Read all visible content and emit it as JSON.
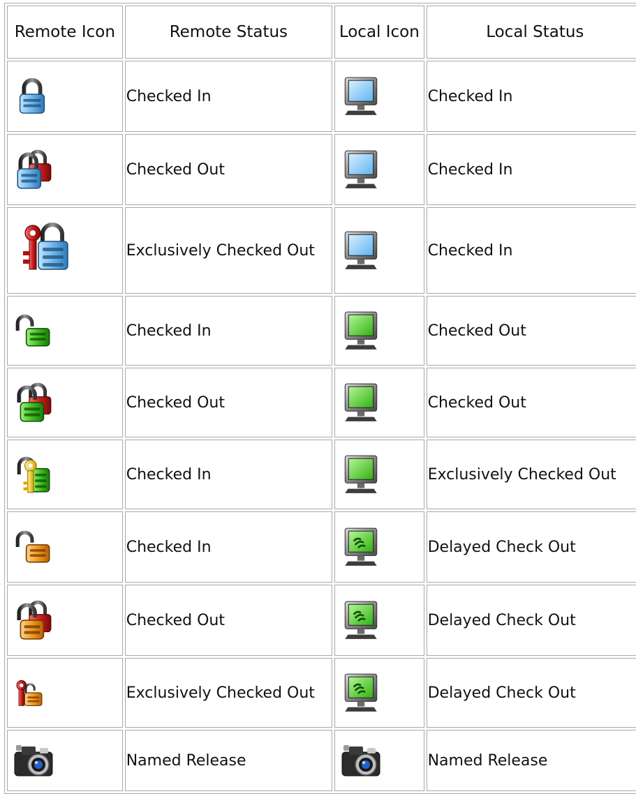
{
  "headers": {
    "remote_icon": "Remote Icon",
    "remote_status": "Remote Status",
    "local_icon": "Local Icon",
    "local_status": "Local Status"
  },
  "rows": [
    {
      "remote_icon": "blue-lock-closed-icon",
      "remote_status": "Checked In",
      "local_icon": "monitor-blue-icon",
      "local_status": "Checked In"
    },
    {
      "remote_icon": "blue-lock-checked-out-icon",
      "remote_status": "Checked Out",
      "local_icon": "monitor-blue-icon",
      "local_status": "Checked In"
    },
    {
      "remote_icon": "blue-lock-exclusive-key-icon",
      "remote_status": "Exclusively Checked Out",
      "local_icon": "monitor-blue-icon",
      "local_status": "Checked In"
    },
    {
      "remote_icon": "green-lock-open-icon",
      "remote_status": "Checked In",
      "local_icon": "monitor-green-icon",
      "local_status": "Checked Out"
    },
    {
      "remote_icon": "green-lock-checked-out-icon",
      "remote_status": "Checked Out",
      "local_icon": "monitor-green-icon",
      "local_status": "Checked Out"
    },
    {
      "remote_icon": "green-lock-yellow-key-icon",
      "remote_status": "Checked In",
      "local_icon": "monitor-green-icon",
      "local_status": "Exclusively Checked Out"
    },
    {
      "remote_icon": "orange-lock-open-icon",
      "remote_status": "Checked In",
      "local_icon": "monitor-green-delayed-icon",
      "local_status": "Delayed Check Out"
    },
    {
      "remote_icon": "orange-lock-checked-out-icon",
      "remote_status": "Checked Out",
      "local_icon": "monitor-green-delayed-icon",
      "local_status": "Delayed Check Out"
    },
    {
      "remote_icon": "orange-lock-red-key-icon",
      "remote_status": "Exclusively Checked Out",
      "local_icon": "monitor-green-delayed-icon",
      "local_status": "Delayed Check Out"
    },
    {
      "remote_icon": "camera-icon",
      "remote_status": "Named Release",
      "local_icon": "camera-icon",
      "local_status": "Named Release"
    }
  ]
}
